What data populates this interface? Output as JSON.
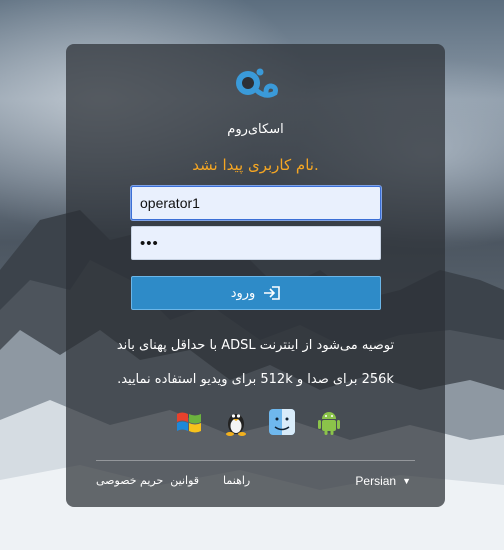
{
  "app": {
    "name": "اسکای‌روم",
    "logo_icon": "skyroom-logo-icon",
    "accent_color": "#2e8bc8"
  },
  "login": {
    "error_message": "نام کاربری پیدا نشد.",
    "error_color": "#f5a623",
    "username_value": "operator1",
    "password_value": "•••",
    "submit_label": "ورود",
    "submit_icon": "sign-in-icon"
  },
  "notice": {
    "line1": "توصیه می‌شود از اینترنت ADSL با حداقل پهنای باند",
    "line2": "256k برای صدا و 512k برای ویدیو استفاده نمایید."
  },
  "platforms": [
    {
      "name": "android-icon"
    },
    {
      "name": "mac-finder-icon"
    },
    {
      "name": "linux-tux-icon"
    },
    {
      "name": "windows-icon"
    }
  ],
  "footer": {
    "links": [
      "راهنما",
      "قوانین",
      "حریم خصوصی"
    ],
    "language": "Persian"
  }
}
